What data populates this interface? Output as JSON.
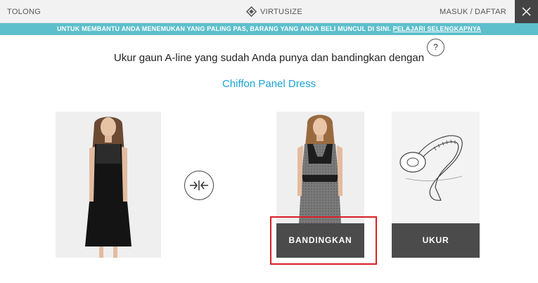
{
  "header": {
    "help_label": "TOLONG",
    "brand_name": "VIRTUSIZE",
    "login_label": "MASUK",
    "separator": "/",
    "signup_label": "DAFTAR"
  },
  "banner": {
    "text": "UNTUK MEMBANTU ANDA MENEMUKAN YANG PALING PAS, BARANG YANG ANDA BELI MUNCUL DI SINI.",
    "link_label": "PELAJARI SELENGKAPNYA"
  },
  "main": {
    "headline": "Ukur gaun A-line yang sudah Anda punya dan bandingkan dengan",
    "product_name": "Chiffon Panel Dress",
    "help_glyph": "?",
    "compare_button": "BANDINGKAN",
    "measure_button": "UKUR"
  },
  "colors": {
    "accent": "#5ebfcc",
    "link": "#1aa3d4",
    "button": "#4b4b4b",
    "highlight": "#d91f26"
  }
}
